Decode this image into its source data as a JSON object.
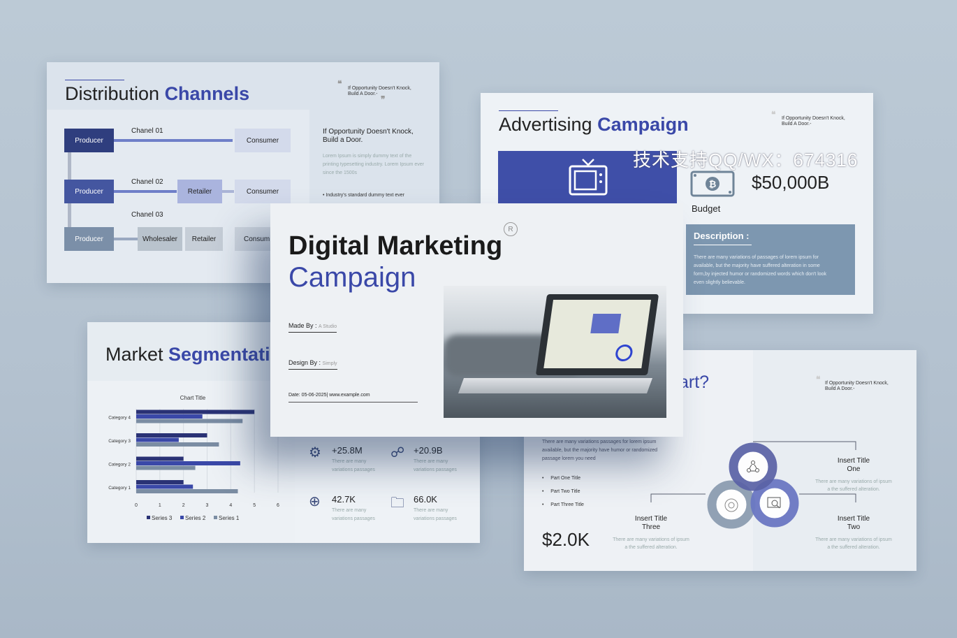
{
  "watermark": "技术支持QQ/WX：674316",
  "distribution": {
    "title_a": "Distribution ",
    "title_b": "Channels",
    "quote": "If Opportunity Doesn't Knock,\nBuild A Door.-",
    "heading": "If Opportunity Doesn't Knock,\nBuild a Door.",
    "body": "Lorem Ipsum is simply dummy text of the printing typesetting industry. Lorem Ipsum ever since the 1500s",
    "bullet": "Industry's standard dummy text ever",
    "channels": [
      "Chanel 01",
      "Chanel 02",
      "Chanel 03"
    ],
    "nodes": {
      "producer": "Producer",
      "consumer": "Consumer",
      "retailer": "Retailer",
      "wholesaler": "Wholesaler",
      "consumer_cut": "Consum"
    }
  },
  "advertising": {
    "title_a": "Advertising ",
    "title_b": "Campaign",
    "quote": "If Opportunity Doesn't Knock,\nBuild A Door.-",
    "budget_value": "$50,000B",
    "budget_label": "Budget",
    "desc_title": "Description :",
    "desc_body": "There are many variations of passages of lorem ipsum for available, but the majority have suffered alteration in some form,by injected humor or randomized words which don't look even slightly believable."
  },
  "market": {
    "title_a": "Market ",
    "title_b": "Segmentati",
    "stats": [
      {
        "value": "+25.8M",
        "desc": "There are many variations  passages",
        "icon": "gear-icon"
      },
      {
        "value": "+20.9B",
        "desc": "There are many variations  passages",
        "icon": "network-icon"
      },
      {
        "value": "42.7K",
        "desc": "There are many variations  passages",
        "icon": "target-icon"
      },
      {
        "value": "66.0K",
        "desc": "There are many variations  passages",
        "icon": "folder-search-icon"
      }
    ]
  },
  "chart_data": {
    "type": "bar",
    "orientation": "horizontal",
    "title": "Chart Title",
    "categories": [
      "Category 1",
      "Category 2",
      "Category 3",
      "Category 4"
    ],
    "series": [
      {
        "name": "Series 3",
        "color": "#2a3275",
        "values": [
          2,
          2,
          3,
          5
        ]
      },
      {
        "name": "Series 2",
        "color": "#3a48a8",
        "values": [
          2.4,
          4.4,
          1.8,
          2.8
        ]
      },
      {
        "name": "Series 1",
        "color": "#7b8da3",
        "values": [
          4.3,
          2.5,
          3.5,
          4.5
        ]
      }
    ],
    "xlim": [
      0,
      6
    ],
    "xticks": [
      "0",
      "1",
      "2",
      "3",
      "4",
      "5",
      "6"
    ],
    "grid": true,
    "legend": "bottom"
  },
  "parts": {
    "title": "art?",
    "quote": "If Opportunity Doesn't Knock,\nBuild A Door.-",
    "body": "There are many variations passages for lorem ipsum available, but the majority have humor or randomized passage lorem you need",
    "bullets": [
      "Part One Title",
      "Part Two Title",
      "Part Three Title"
    ],
    "value": "$2.0K",
    "items": [
      {
        "title": "Insert Title\nOne",
        "desc": "There are many variations of ipsum\na the suffered alteration."
      },
      {
        "title": "Insert Title\nTwo",
        "desc": "There are many variations of ipsum\na the suffered alteration."
      },
      {
        "title": "Insert Title\nThree",
        "desc": "There are many variations of ipsum\na the suffered alteration."
      }
    ]
  },
  "cover": {
    "title_a": "Digital Marketing",
    "title_b": "Campaign",
    "registered": "R",
    "made_by_label": "Made By :",
    "made_by": "A Studio",
    "design_by_label": "Design By :",
    "design_by": "Simply",
    "footer": "Date: 05-06-2025| www.example.com"
  }
}
